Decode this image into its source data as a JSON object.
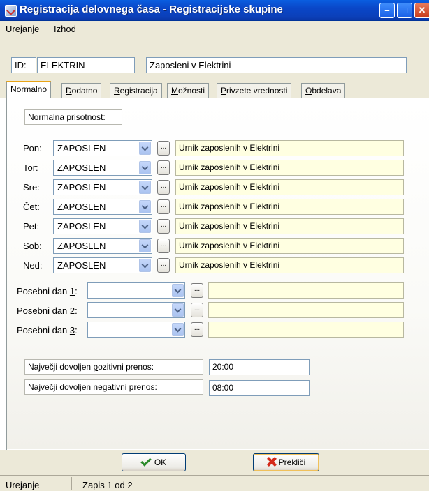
{
  "window": {
    "title": "Registracija delovnega časa - Registracijske skupine"
  },
  "menu": [
    {
      "pre": "",
      "key": "U",
      "post": "rejanje"
    },
    {
      "pre": "",
      "key": "I",
      "post": "zhod"
    }
  ],
  "record": {
    "id_label": "ID:",
    "id_value": "ELEKTRIN",
    "description": "Zaposleni v Elektrini"
  },
  "tabs": [
    {
      "pre": "",
      "key": "N",
      "post": "ormalno"
    },
    {
      "pre": "",
      "key": "D",
      "post": "odatno"
    },
    {
      "pre": "",
      "key": "R",
      "post": "egistracija"
    },
    {
      "pre": "",
      "key": "M",
      "post": "ožnosti"
    },
    {
      "pre": "",
      "key": "P",
      "post": "rivzete vrednosti"
    },
    {
      "pre": "",
      "key": "O",
      "post": "bdelava"
    }
  ],
  "attendance": {
    "pre": "Normalna ",
    "key": "p",
    "post": "risotnost:"
  },
  "days": [
    {
      "label": "Pon:",
      "value": "ZAPOSLEN",
      "desc": "Urnik zaposlenih v Elektrini"
    },
    {
      "label": "Tor:",
      "value": "ZAPOSLEN",
      "desc": "Urnik zaposlenih v Elektrini"
    },
    {
      "label": "Sre:",
      "value": "ZAPOSLEN",
      "desc": "Urnik zaposlenih v Elektrini"
    },
    {
      "label": "Čet:",
      "value": "ZAPOSLEN",
      "desc": "Urnik zaposlenih v Elektrini"
    },
    {
      "label": "Pet:",
      "value": "ZAPOSLEN",
      "desc": "Urnik zaposlenih v Elektrini"
    },
    {
      "label": "Sob:",
      "value": "ZAPOSLEN",
      "desc": "Urnik zaposlenih v Elektrini"
    },
    {
      "label": "Ned:",
      "value": "ZAPOSLEN",
      "desc": "Urnik zaposlenih v Elektrini"
    }
  ],
  "dots_label": "...",
  "special_days": [
    {
      "pre": "Posebni dan ",
      "key": "1",
      "post": ":"
    },
    {
      "pre": "Posebni dan ",
      "key": "2",
      "post": ":"
    },
    {
      "pre": "Posebni dan ",
      "key": "3",
      "post": ":"
    }
  ],
  "transfer": {
    "positive": {
      "pre": "Največji dovoljen ",
      "key": "p",
      "post": "ozitivni prenos:",
      "value": "20:00"
    },
    "negative": {
      "pre": "Največji dovoljen ",
      "key": "n",
      "post": "egativni prenos:",
      "value": "08:00"
    }
  },
  "buttons": {
    "ok": "OK",
    "cancel": "Prekliči"
  },
  "status": {
    "mode": "Urejanje",
    "record": "Zapis 1 od 2"
  },
  "icons": {
    "title": "app-icon",
    "ok": "check-icon",
    "cancel": "x-icon"
  },
  "colors": {
    "title_bar": "#0a4ecc",
    "tab_accent": "#e8a418",
    "field_desc_bg": "#ffffe1"
  }
}
